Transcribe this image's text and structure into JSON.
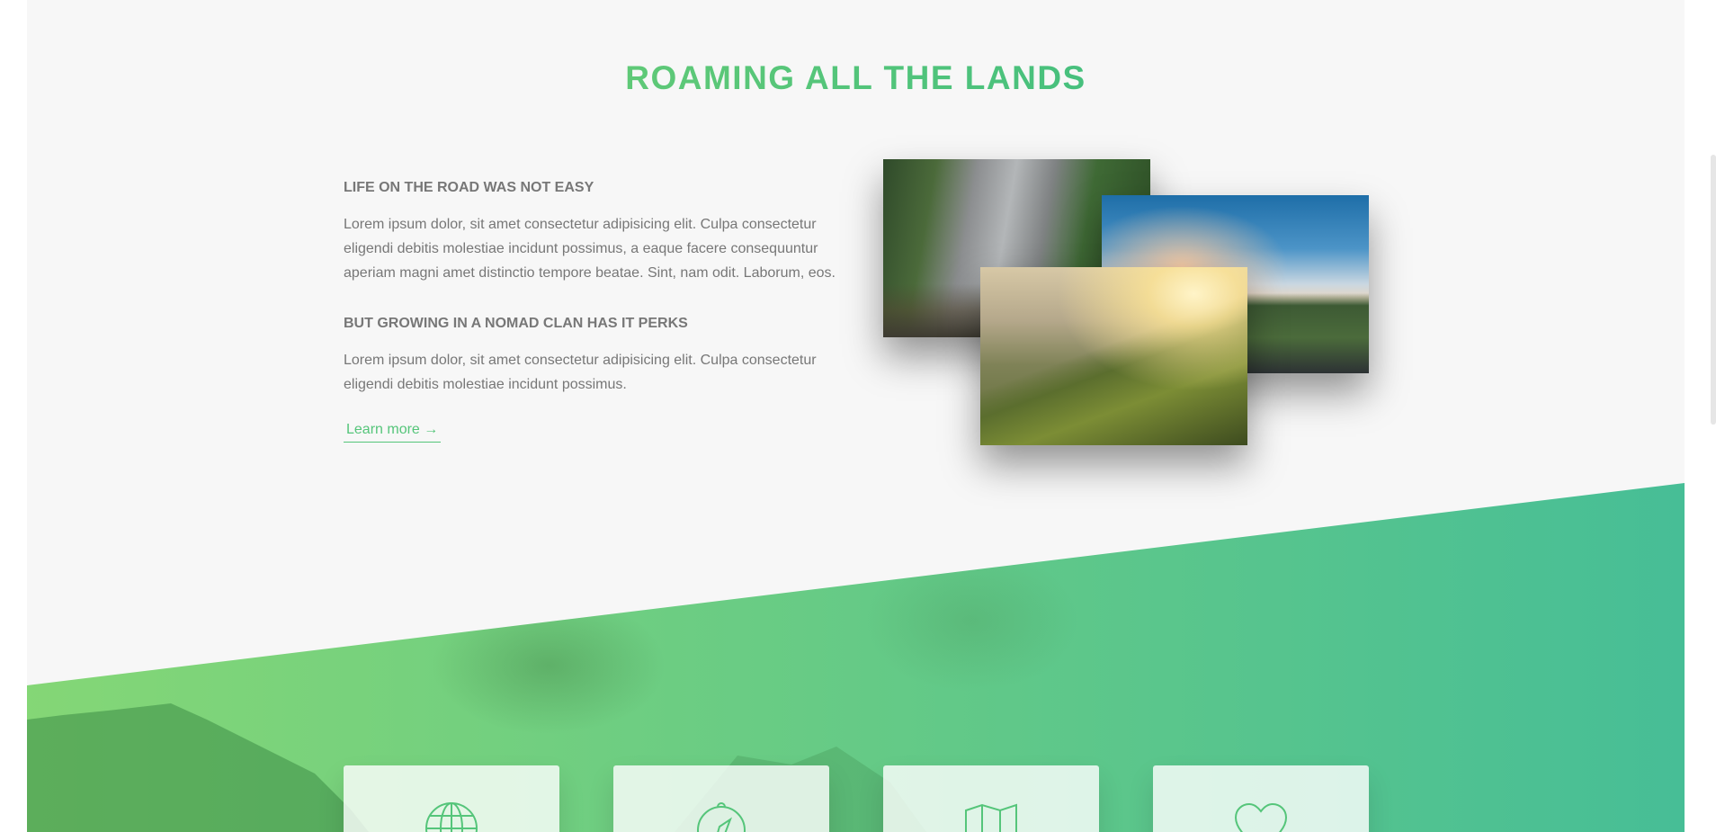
{
  "section": {
    "title": "ROAMING ALL THE LANDS",
    "title_gradient": [
      "#7ed56f",
      "#28b485"
    ]
  },
  "about": {
    "heading_1": "LIFE ON THE ROAD WAS NOT EASY",
    "paragraph_1": "Lorem ipsum dolor, sit amet consectetur adipisicing elit. Culpa consectetur eligendi debitis molestiae incidunt possimus, a eaque facere consequuntur aperiam magni amet distinctio tempore beatae. Sint, nam odit. Laborum, eos.",
    "heading_2": "BUT GROWING IN A NOMAD CLAN HAS IT PERKS",
    "paragraph_2": "Lorem ipsum dolor, sit amet consectetur adipisicing elit. Culpa consectetur eligendi debitis molestiae incidunt possimus.",
    "link_label": "Learn more →"
  },
  "composition": {
    "photos": [
      "forest-mountain-photo",
      "cyclist-road-photo",
      "mountain-ridge-hiker-photo"
    ]
  },
  "features": {
    "icons": [
      "globe-icon",
      "compass-icon",
      "map-icon",
      "heart-icon"
    ]
  },
  "colors": {
    "accent": "#55c57a",
    "text": "#777777",
    "background": "#f7f7f7"
  }
}
